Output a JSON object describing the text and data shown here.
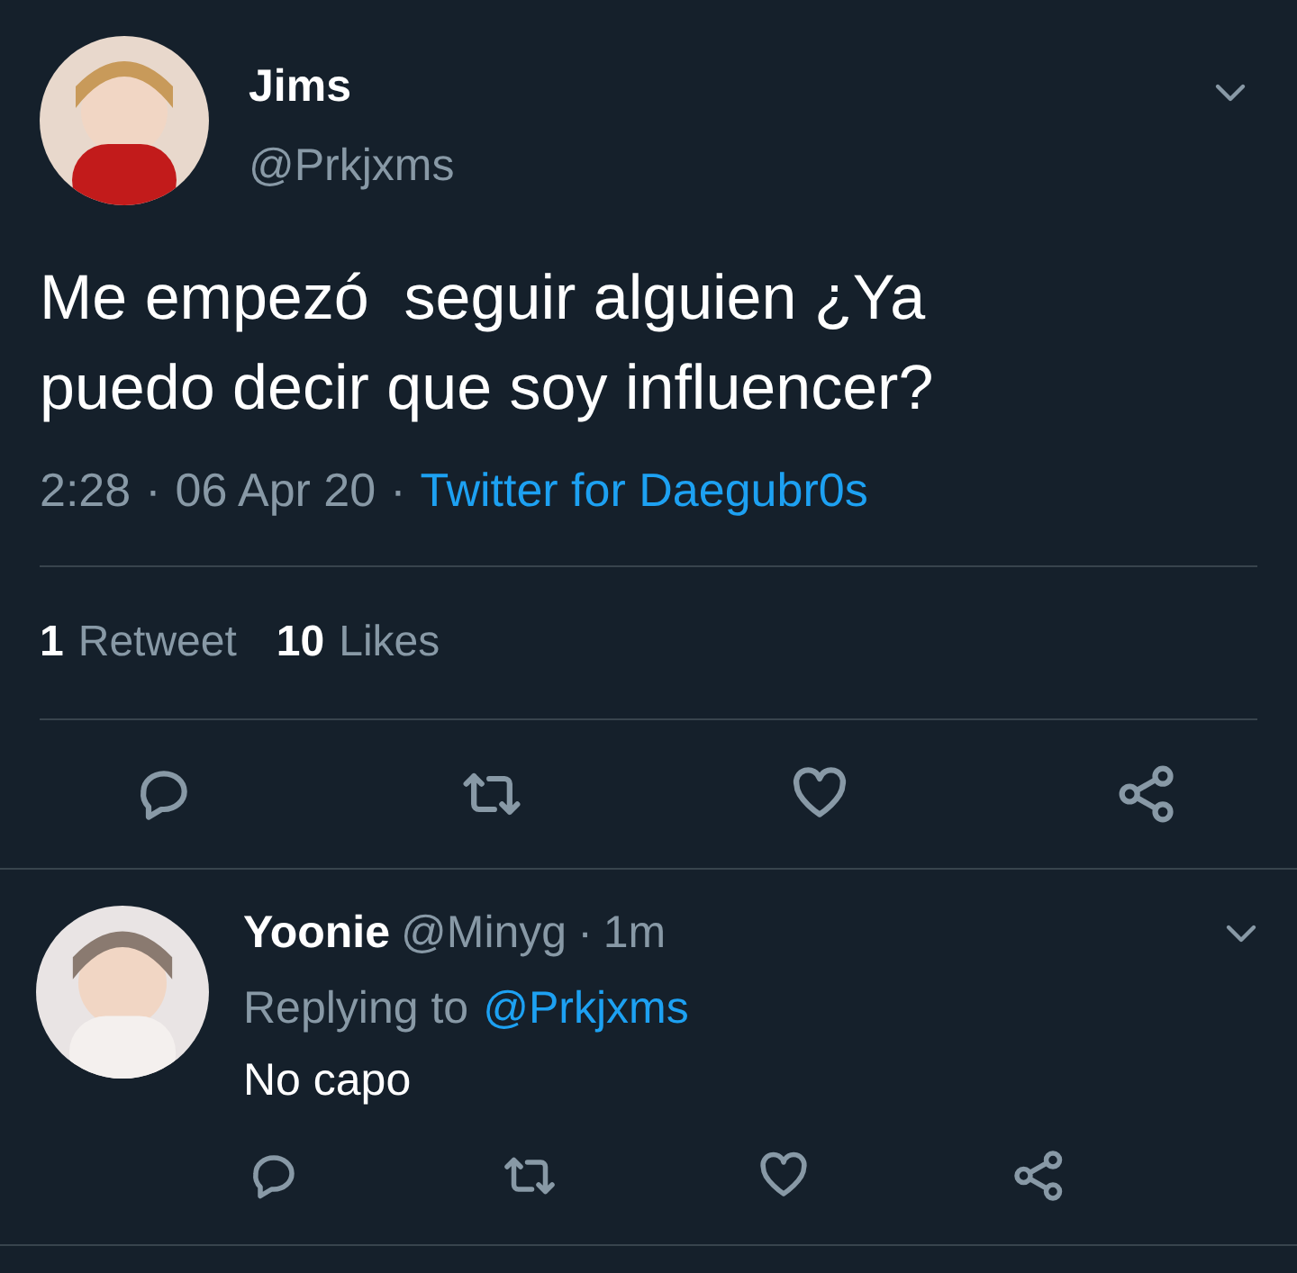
{
  "tweet": {
    "name": "Jims",
    "handle": "@Prkjxms",
    "text": "Me empezó  seguir alguien ¿Ya puedo decir que soy influencer?",
    "time": "2:28",
    "separator_1": "·",
    "date": "06 Apr 20",
    "separator_2": "·",
    "source": "Twitter for Daegubr0s",
    "stats": [
      {
        "count": "1",
        "label": "Retweet"
      },
      {
        "count": "10",
        "label": "Likes"
      }
    ]
  },
  "reply": {
    "name": "Yoonie",
    "handle": "@Minyg",
    "separator": "·",
    "age": "1m",
    "replying_label": "Replying to",
    "replying_to": "@Prkjxms",
    "text": "No capo"
  }
}
